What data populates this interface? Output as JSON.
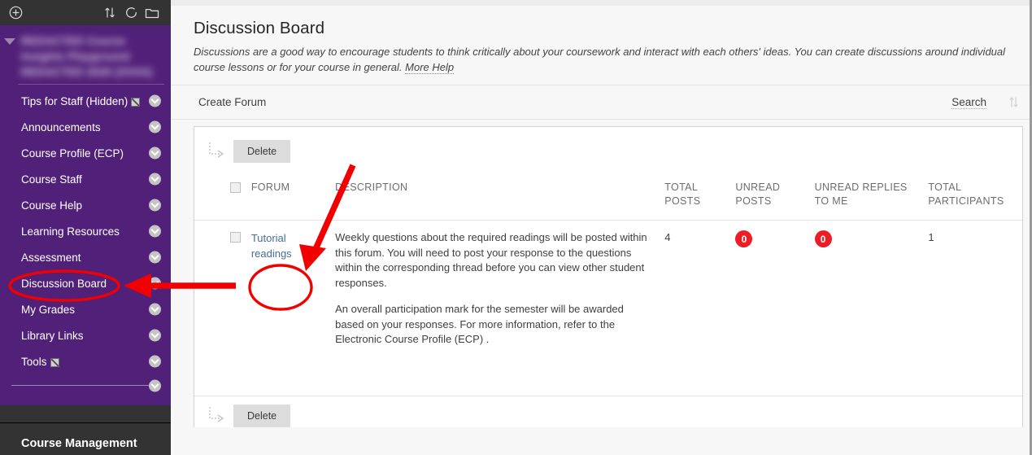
{
  "sidebar": {
    "toolbar_icons": [
      {
        "name": "add-circle-icon",
        "label": "Add"
      },
      {
        "name": "reorder-arrows-icon",
        "label": "Reorder"
      },
      {
        "name": "refresh-icon",
        "label": "Refresh"
      },
      {
        "name": "folder-icon",
        "label": "Folder"
      }
    ],
    "course_title": "REDACTED Course Insights Playground REDACTED 2020 (XXXX)",
    "items": [
      {
        "label": "Tips for Staff (Hidden)",
        "hidden_icon": true,
        "active": false
      },
      {
        "label": "Announcements",
        "hidden_icon": false,
        "active": false
      },
      {
        "label": "Course Profile (ECP)",
        "hidden_icon": false,
        "active": false
      },
      {
        "label": "Course Staff",
        "hidden_icon": false,
        "active": false
      },
      {
        "label": "Course Help",
        "hidden_icon": false,
        "active": false
      },
      {
        "label": "Learning Resources",
        "hidden_icon": false,
        "active": false
      },
      {
        "label": "Assessment",
        "hidden_icon": false,
        "active": false
      },
      {
        "label": "Discussion Board",
        "hidden_icon": false,
        "active": true
      },
      {
        "label": "My Grades",
        "hidden_icon": false,
        "active": false
      },
      {
        "label": "Library Links",
        "hidden_icon": false,
        "active": false
      },
      {
        "label": "Tools",
        "hidden_icon": true,
        "active": false
      }
    ],
    "course_management_label": "Course Management"
  },
  "page": {
    "title": "Discussion Board",
    "description": "Discussions are a good way to encourage students to think critically about your coursework and interact with each others' ideas. You can create discussions around individual course lessons or for your course in general.",
    "more_help_label": "More Help"
  },
  "action_bar": {
    "create_forum_label": "Create Forum",
    "search_label": "Search",
    "sort_icon": "sort-arrows-icon"
  },
  "toolbar": {
    "delete_label": "Delete",
    "delete_label_bottom": "Delete"
  },
  "table": {
    "columns": [
      {
        "key": "checkbox",
        "label": ""
      },
      {
        "key": "forum",
        "label": "FORUM"
      },
      {
        "key": "description",
        "label": "DESCRIPTION"
      },
      {
        "key": "total_posts",
        "label": "TOTAL POSTS"
      },
      {
        "key": "unread_posts",
        "label": "UNREAD POSTS"
      },
      {
        "key": "unread_replies",
        "label": "UNREAD REPLIES TO ME"
      },
      {
        "key": "total_participants",
        "label": "TOTAL PARTICIPANTS"
      }
    ],
    "rows": [
      {
        "forum": "Tutorial readings",
        "description_p1": "Weekly questions about the required readings will be posted within this forum. You will need to post your response to the questions within the corresponding thread before you can view other student responses.",
        "description_p2": "An overall participation mark for the semester will be awarded based on your responses. For more information, refer to the Electronic Course Profile (ECP) .",
        "total_posts": "4",
        "unread_posts": "0",
        "unread_replies": "0",
        "total_participants": "1"
      }
    ]
  },
  "colors": {
    "sidebar_purple": "#512179",
    "topbar_dark": "#333333",
    "badge_red": "#ee1c25",
    "annotation_red": "#f20000",
    "link_blue": "#4a6a9a"
  },
  "annotations": [
    {
      "name": "highlight-ellipse-discussion-board",
      "shape": "ellipse"
    },
    {
      "name": "pointer-arrow-to-discussion-board",
      "shape": "arrow"
    },
    {
      "name": "pointer-arrow-to-tutorial-readings",
      "shape": "arrow"
    },
    {
      "name": "highlight-ellipse-tutorial-readings",
      "shape": "ellipse"
    }
  ]
}
